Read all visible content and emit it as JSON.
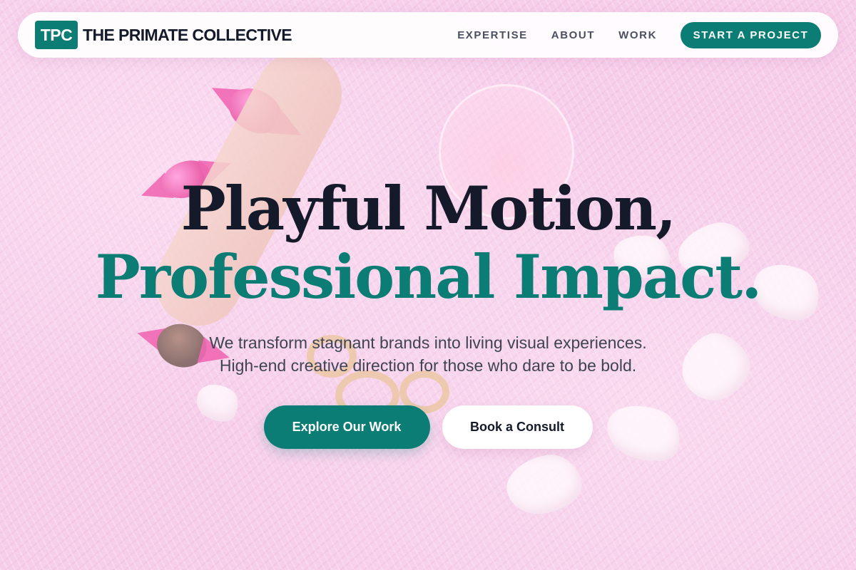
{
  "brand": {
    "logo_text": "TPC",
    "name": "THE PRIMATE COLLECTIVE"
  },
  "nav": {
    "links": [
      {
        "label": "EXPERTISE"
      },
      {
        "label": "ABOUT"
      },
      {
        "label": "WORK"
      }
    ],
    "cta_label": "START A PROJECT"
  },
  "hero": {
    "headline_line1": "Playful Motion,",
    "headline_line2": "Professional Impact.",
    "subtext_line1": "We transform stagnant brands into living visual experiences.",
    "subtext_line2": "High-end creative direction for those who dare to be bold.",
    "primary_button": "Explore Our Work",
    "secondary_button": "Book a Consult"
  },
  "colors": {
    "accent": "#0b7d74",
    "text_dark": "#141a2a",
    "background": "#f2bde3"
  }
}
